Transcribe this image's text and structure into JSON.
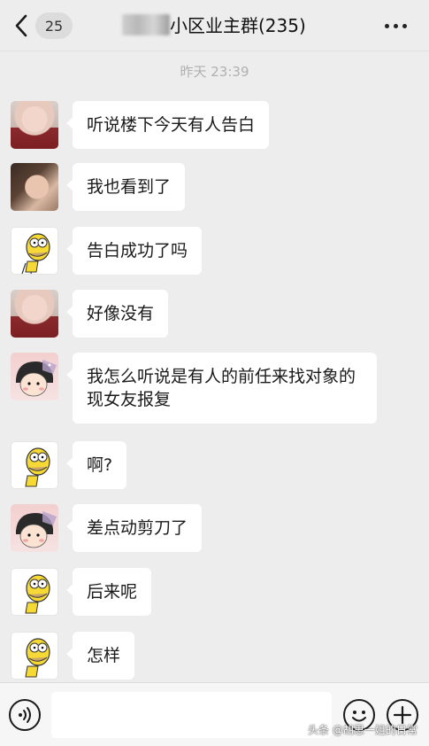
{
  "header": {
    "unread_count": "25",
    "title": "小区业主群(235)"
  },
  "timestamp": "昨天 23:39",
  "messages": [
    {
      "avatar": "girl-red-dress",
      "text": "听说楼下今天有人告白"
    },
    {
      "avatar": "girl-dark-hair",
      "text": "我也看到了"
    },
    {
      "avatar": "homer-cartoon",
      "text": "告白成功了吗"
    },
    {
      "avatar": "girl-red-dress",
      "text": "好像没有"
    },
    {
      "avatar": "maruko-cartoon",
      "text": "我怎么听说是有人的前任来找对象的现女友报复"
    },
    {
      "avatar": "homer-cartoon",
      "text": "啊?"
    },
    {
      "avatar": "maruko-cartoon",
      "text": "差点动剪刀了"
    },
    {
      "avatar": "homer-cartoon",
      "text": "后来呢"
    },
    {
      "avatar": "homer-cartoon",
      "text": "怎样"
    }
  ],
  "watermark": "头条 @胡思一姐的日常",
  "icons": [
    "back-chevron-icon",
    "more-dots-icon",
    "voice-icon",
    "emoji-icon",
    "plus-icon"
  ]
}
